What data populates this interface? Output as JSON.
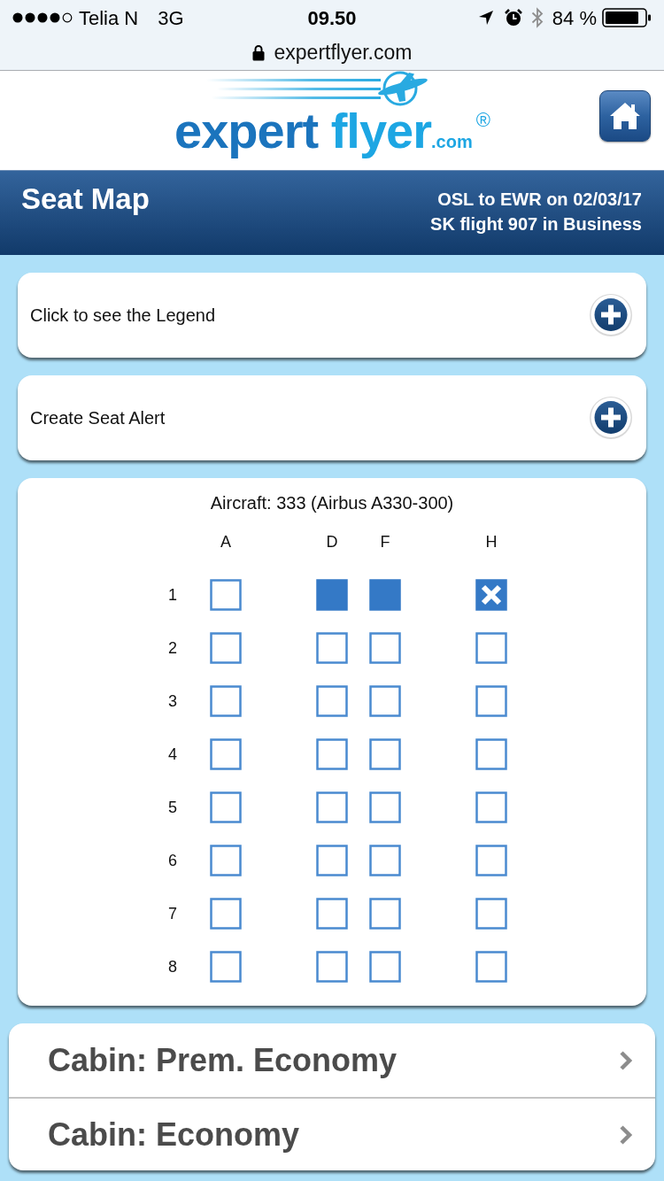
{
  "status_bar": {
    "carrier": "Telia N",
    "network": "3G",
    "time": "09.50",
    "battery": "84 %"
  },
  "address_bar": {
    "url": "expertflyer.com"
  },
  "logo": {
    "word_1": "expert",
    "word_2": "flyer",
    "suffix": ".com",
    "mark": "®"
  },
  "banner": {
    "title": "Seat Map",
    "route": "OSL to EWR on 02/03/17",
    "flight": "SK flight 907 in Business"
  },
  "panels": [
    {
      "label": "Click to see the Legend",
      "expanded": false
    },
    {
      "label": "Create Seat Alert",
      "expanded": false
    }
  ],
  "seat_map": {
    "aircraft": "Aircraft: 333 (Airbus A330-300)",
    "column_groups": [
      [
        "A"
      ],
      [
        "D",
        "F"
      ],
      [
        "H"
      ]
    ],
    "rows": [
      {
        "number": "1",
        "seats": [
          {
            "kind": "available"
          },
          {
            "kind": "occupied"
          },
          {
            "kind": "occupied"
          },
          {
            "kind": "blocked"
          }
        ]
      },
      {
        "number": "2",
        "seats": [
          {
            "kind": "available"
          },
          {
            "kind": "available"
          },
          {
            "kind": "available"
          },
          {
            "kind": "available"
          }
        ]
      },
      {
        "number": "3",
        "seats": [
          {
            "kind": "available"
          },
          {
            "kind": "available"
          },
          {
            "kind": "available"
          },
          {
            "kind": "available"
          }
        ]
      },
      {
        "number": "4",
        "seats": [
          {
            "kind": "available"
          },
          {
            "kind": "available"
          },
          {
            "kind": "available"
          },
          {
            "kind": "available"
          }
        ]
      },
      {
        "number": "5",
        "seats": [
          {
            "kind": "available"
          },
          {
            "kind": "available"
          },
          {
            "kind": "available"
          },
          {
            "kind": "available"
          }
        ]
      },
      {
        "number": "6",
        "seats": [
          {
            "kind": "available"
          },
          {
            "kind": "available"
          },
          {
            "kind": "available"
          },
          {
            "kind": "available"
          }
        ]
      },
      {
        "number": "7",
        "seats": [
          {
            "kind": "available"
          },
          {
            "kind": "available"
          },
          {
            "kind": "available"
          },
          {
            "kind": "available"
          }
        ]
      },
      {
        "number": "8",
        "seats": [
          {
            "kind": "available"
          },
          {
            "kind": "available"
          },
          {
            "kind": "available"
          },
          {
            "kind": "available"
          }
        ]
      }
    ]
  },
  "cabins": [
    {
      "label": "Cabin: Prem. Economy"
    },
    {
      "label": "Cabin: Economy"
    }
  ]
}
